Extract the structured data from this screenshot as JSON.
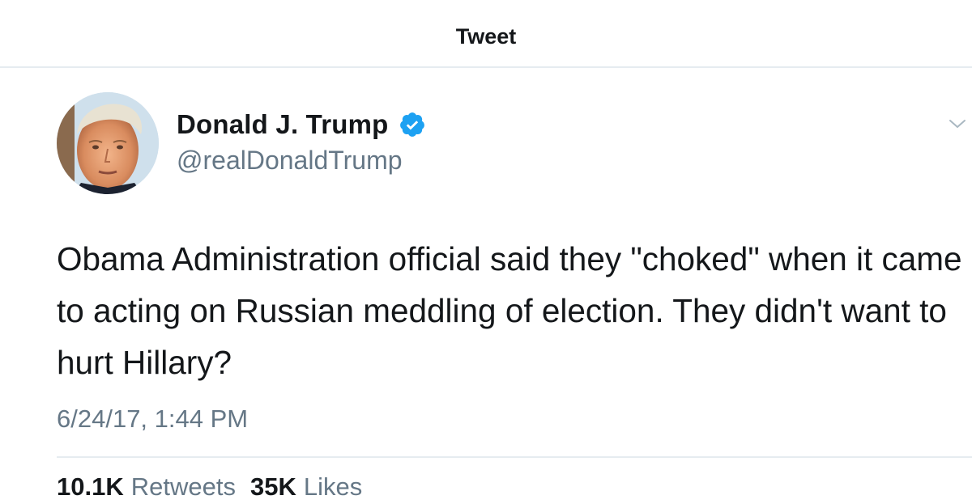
{
  "header": {
    "title": "Tweet"
  },
  "tweet": {
    "display_name": "Donald J. Trump",
    "handle": "@realDonaldTrump",
    "verified_icon": "verified-badge-icon",
    "text": "Obama Administration official said they \"choked\" when it came to acting on Russian meddling of election. They didn't want to hurt Hillary?",
    "timestamp": "6/24/17, 1:44 PM",
    "retweets_count": "10.1K",
    "retweets_label": "Retweets",
    "likes_count": "35K",
    "likes_label": "Likes"
  },
  "colors": {
    "text_primary": "#14171a",
    "text_secondary": "#657786",
    "verified_blue": "#1da1f2",
    "divider": "#e6ecf0"
  }
}
